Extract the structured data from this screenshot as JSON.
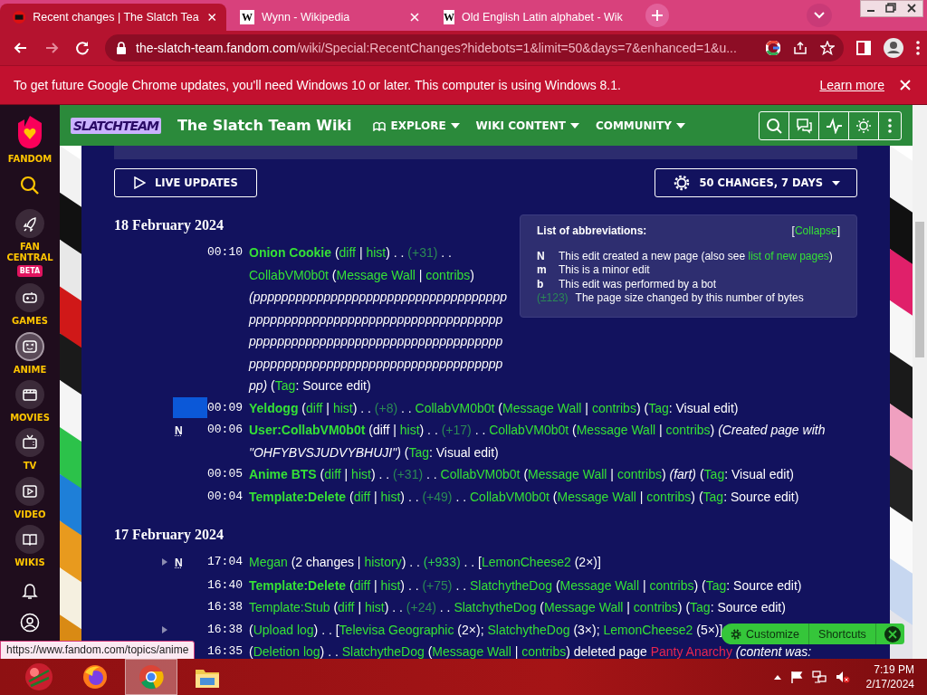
{
  "tabs": [
    {
      "title": "Recent changes | The Slatch Tea",
      "kind": "fandom",
      "selected": true
    },
    {
      "title": "Wynn - Wikipedia",
      "kind": "wikipedia",
      "icon_text": "W",
      "selected": false
    },
    {
      "title": "Old English Latin alphabet - Wik",
      "kind": "wikipedia",
      "icon_text": "W",
      "selected": false
    }
  ],
  "toolbar": {
    "nav": [
      {
        "kind": "back",
        "disabled": false
      },
      {
        "kind": "forward",
        "disabled": true
      },
      {
        "kind": "reload",
        "disabled": false
      }
    ],
    "url_host": "the-slatch-team.fandom.com",
    "url_path": "/wiki/Special:RecentChanges?hidebots=1&limit=50&days=7&enhanced=1&u..."
  },
  "infobar": {
    "message": "To get future Google Chrome updates, you'll need Windows 10 or later. This computer is using Windows 8.1.",
    "link": "Learn more"
  },
  "rail": {
    "logo_label": "FANDOM",
    "items": [
      {
        "label": "FAN CENTRAL",
        "kind": "rocket",
        "badge": "BETA",
        "selected": false
      },
      {
        "label": "GAMES",
        "kind": "gamepad",
        "selected": false
      },
      {
        "label": "ANIME",
        "kind": "face",
        "selected": true
      },
      {
        "label": "MOVIES",
        "kind": "clapper",
        "selected": false
      },
      {
        "label": "TV",
        "kind": "tv",
        "selected": false
      },
      {
        "label": "VIDEO",
        "kind": "play",
        "selected": false
      },
      {
        "label": "WIKIS",
        "kind": "book",
        "selected": false
      }
    ]
  },
  "wiki_header": {
    "logo_text": "SLATCHTEAM",
    "title": "The Slatch Team Wiki",
    "nav": [
      "EXPLORE",
      "WIKI CONTENT",
      "COMMUNITY"
    ]
  },
  "controls": {
    "live_updates": "LIVE UPDATES",
    "filter": "50 CHANGES, 7 DAYS"
  },
  "abbreviations": {
    "title": "List of abbreviations:",
    "collapse": [
      {
        "kind": "text",
        "text": "["
      },
      {
        "kind": "link",
        "text": "Collapse"
      },
      {
        "kind": "text",
        "text": "]"
      }
    ],
    "items": [
      {
        "key": "N",
        "kind": "letter",
        "desc": [
          {
            "kind": "text",
            "text": "This edit created a new page (also see "
          },
          {
            "kind": "link",
            "text": "list of new pages"
          },
          {
            "kind": "text",
            "text": ")"
          }
        ]
      },
      {
        "key": "m",
        "kind": "letter",
        "desc": [
          {
            "kind": "text",
            "text": "This is a minor edit"
          }
        ]
      },
      {
        "key": "b",
        "kind": "letter",
        "desc": [
          {
            "kind": "text",
            "text": "This edit was performed by a bot"
          }
        ]
      },
      {
        "key": "(±123)",
        "kind": "size",
        "desc": [
          {
            "kind": "text",
            "text": "The page size changed by this number of bytes"
          }
        ]
      }
    ]
  },
  "days": [
    {
      "date": "18 February 2024",
      "entries": [
        {
          "time": "00:10",
          "grouped": false,
          "marked": false,
          "parts": [
            {
              "kind": "title",
              "text": "Onion Cookie"
            },
            {
              "kind": "text",
              "text": " ("
            },
            {
              "kind": "link",
              "text": "diff"
            },
            {
              "kind": "text",
              "text": " | "
            },
            {
              "kind": "link",
              "text": "hist"
            },
            {
              "kind": "text",
              "text": ") . . "
            },
            {
              "kind": "size",
              "text": "(+31)"
            },
            {
              "kind": "text",
              "text": " . . "
            },
            {
              "kind": "link",
              "text": "CollabVM0b0t"
            },
            {
              "kind": "text",
              "text": " ("
            },
            {
              "kind": "link",
              "text": "Message Wall"
            },
            {
              "kind": "text",
              "text": " | "
            },
            {
              "kind": "link",
              "text": "contribs"
            },
            {
              "kind": "text",
              "text": ") "
            },
            {
              "kind": "italic",
              "text": "(pppppppppppppppppppppppppppppppppppppppppppppppppppppppppppppppppppppppppppppppppppppppppppppppppppppppppppppppppppppppppppppppppppppppppppppppppp)"
            },
            {
              "kind": "text",
              "text": " ("
            },
            {
              "kind": "link",
              "text": "Tag"
            },
            {
              "kind": "text",
              "text": ": Source edit)"
            }
          ]
        },
        {
          "time": "00:09",
          "grouped": false,
          "marked": true,
          "parts": [
            {
              "kind": "title",
              "text": "Yeldogg"
            },
            {
              "kind": "text",
              "text": " ("
            },
            {
              "kind": "link",
              "text": "diff"
            },
            {
              "kind": "text",
              "text": " | "
            },
            {
              "kind": "link",
              "text": "hist"
            },
            {
              "kind": "text",
              "text": ") . . "
            },
            {
              "kind": "size",
              "text": "(+8)"
            },
            {
              "kind": "text",
              "text": " . . "
            },
            {
              "kind": "link",
              "text": "CollabVM0b0t"
            },
            {
              "kind": "text",
              "text": " ("
            },
            {
              "kind": "link",
              "text": "Message Wall"
            },
            {
              "kind": "text",
              "text": " | "
            },
            {
              "kind": "link",
              "text": "contribs"
            },
            {
              "kind": "text",
              "text": ") ("
            },
            {
              "kind": "link",
              "text": "Tag"
            },
            {
              "kind": "text",
              "text": ": Visual edit)"
            }
          ]
        },
        {
          "time": "00:06",
          "flag": "N",
          "grouped": false,
          "marked": false,
          "parts": [
            {
              "kind": "title",
              "text": "User:CollabVM0b0t"
            },
            {
              "kind": "text",
              "text": " (diff | "
            },
            {
              "kind": "link",
              "text": "hist"
            },
            {
              "kind": "text",
              "text": ") . . "
            },
            {
              "kind": "size",
              "text": "(+17)"
            },
            {
              "kind": "text",
              "text": " . . "
            },
            {
              "kind": "link",
              "text": "CollabVM0b0t"
            },
            {
              "kind": "text",
              "text": " ("
            },
            {
              "kind": "link",
              "text": "Message Wall"
            },
            {
              "kind": "text",
              "text": " | "
            },
            {
              "kind": "link",
              "text": "contribs"
            },
            {
              "kind": "text",
              "text": ") "
            },
            {
              "kind": "italic",
              "text": "(Created page with \"OHFYBVSJUDVYBHUJI\")"
            },
            {
              "kind": "text",
              "text": " ("
            },
            {
              "kind": "link",
              "text": "Tag"
            },
            {
              "kind": "text",
              "text": ": Visual edit)"
            }
          ]
        },
        {
          "time": "00:05",
          "grouped": false,
          "marked": false,
          "parts": [
            {
              "kind": "title",
              "text": "Anime BTS"
            },
            {
              "kind": "text",
              "text": " ("
            },
            {
              "kind": "link",
              "text": "diff"
            },
            {
              "kind": "text",
              "text": " | "
            },
            {
              "kind": "link",
              "text": "hist"
            },
            {
              "kind": "text",
              "text": ") . . "
            },
            {
              "kind": "size",
              "text": "(+31)"
            },
            {
              "kind": "text",
              "text": " . . "
            },
            {
              "kind": "link",
              "text": "CollabVM0b0t"
            },
            {
              "kind": "text",
              "text": " ("
            },
            {
              "kind": "link",
              "text": "Message Wall"
            },
            {
              "kind": "text",
              "text": " | "
            },
            {
              "kind": "link",
              "text": "contribs"
            },
            {
              "kind": "text",
              "text": ") "
            },
            {
              "kind": "italic",
              "text": "(fart)"
            },
            {
              "kind": "text",
              "text": " ("
            },
            {
              "kind": "link",
              "text": "Tag"
            },
            {
              "kind": "text",
              "text": ": Visual edit)"
            }
          ]
        },
        {
          "time": "00:04",
          "grouped": false,
          "marked": false,
          "parts": [
            {
              "kind": "title",
              "text": "Template:Delete"
            },
            {
              "kind": "text",
              "text": " ("
            },
            {
              "kind": "link",
              "text": "diff"
            },
            {
              "kind": "text",
              "text": " | "
            },
            {
              "kind": "link",
              "text": "hist"
            },
            {
              "kind": "text",
              "text": ") . . "
            },
            {
              "kind": "size",
              "text": "(+49)"
            },
            {
              "kind": "text",
              "text": " . . "
            },
            {
              "kind": "link",
              "text": "CollabVM0b0t"
            },
            {
              "kind": "text",
              "text": " ("
            },
            {
              "kind": "link",
              "text": "Message Wall"
            },
            {
              "kind": "text",
              "text": " | "
            },
            {
              "kind": "link",
              "text": "contribs"
            },
            {
              "kind": "text",
              "text": ") ("
            },
            {
              "kind": "link",
              "text": "Tag"
            },
            {
              "kind": "text",
              "text": ": Source edit)"
            }
          ]
        }
      ]
    },
    {
      "date": "17 February 2024",
      "entries": [
        {
          "time": "17:04",
          "flag": "N",
          "grouped": true,
          "marked": false,
          "parts": [
            {
              "kind": "link",
              "text": "Megan"
            },
            {
              "kind": "text",
              "text": " (2 changes | "
            },
            {
              "kind": "link",
              "text": "history"
            },
            {
              "kind": "text",
              "text": ") . . "
            },
            {
              "kind": "size_big",
              "text": "(+933)"
            },
            {
              "kind": "text",
              "text": " . . ["
            },
            {
              "kind": "link",
              "text": "LemonCheese2"
            },
            {
              "kind": "text",
              "text": " (2×)]"
            }
          ]
        },
        {
          "time": "16:40",
          "grouped": false,
          "marked": false,
          "parts": [
            {
              "kind": "title",
              "text": "Template:Delete"
            },
            {
              "kind": "text",
              "text": " ("
            },
            {
              "kind": "link",
              "text": "diff"
            },
            {
              "kind": "text",
              "text": " | "
            },
            {
              "kind": "link",
              "text": "hist"
            },
            {
              "kind": "text",
              "text": ") . . "
            },
            {
              "kind": "size",
              "text": "(+75)"
            },
            {
              "kind": "text",
              "text": " . . "
            },
            {
              "kind": "link",
              "text": "SlatchytheDog"
            },
            {
              "kind": "text",
              "text": " ("
            },
            {
              "kind": "link",
              "text": "Message Wall"
            },
            {
              "kind": "text",
              "text": " | "
            },
            {
              "kind": "link",
              "text": "contribs"
            },
            {
              "kind": "text",
              "text": ") ("
            },
            {
              "kind": "link",
              "text": "Tag"
            },
            {
              "kind": "text",
              "text": ": Source edit)"
            }
          ]
        },
        {
          "time": "16:38",
          "grouped": false,
          "marked": false,
          "parts": [
            {
              "kind": "link",
              "text": "Template:Stub"
            },
            {
              "kind": "text",
              "text": " ("
            },
            {
              "kind": "link",
              "text": "diff"
            },
            {
              "kind": "text",
              "text": " | "
            },
            {
              "kind": "link",
              "text": "hist"
            },
            {
              "kind": "text",
              "text": ") . . "
            },
            {
              "kind": "size",
              "text": "(+24)"
            },
            {
              "kind": "text",
              "text": " . . "
            },
            {
              "kind": "link",
              "text": "SlatchytheDog"
            },
            {
              "kind": "text",
              "text": " ("
            },
            {
              "kind": "link",
              "text": "Message Wall"
            },
            {
              "kind": "text",
              "text": " | "
            },
            {
              "kind": "link",
              "text": "contribs"
            },
            {
              "kind": "text",
              "text": ") ("
            },
            {
              "kind": "link",
              "text": "Tag"
            },
            {
              "kind": "text",
              "text": ": Source edit)"
            }
          ]
        },
        {
          "time": "16:38",
          "grouped": true,
          "marked": false,
          "parts": [
            {
              "kind": "text",
              "text": "("
            },
            {
              "kind": "link",
              "text": "Upload log"
            },
            {
              "kind": "text",
              "text": ") . . ["
            },
            {
              "kind": "link",
              "text": "Televisa Geographic"
            },
            {
              "kind": "text",
              "text": " (2×); "
            },
            {
              "kind": "link",
              "text": "SlatchytheDog"
            },
            {
              "kind": "text",
              "text": " (3×); "
            },
            {
              "kind": "link",
              "text": "LemonCheese2"
            },
            {
              "kind": "text",
              "text": " (5×)]"
            }
          ]
        },
        {
          "time": "16:35",
          "grouped": false,
          "marked": false,
          "parts": [
            {
              "kind": "text",
              "text": "("
            },
            {
              "kind": "link",
              "text": "Deletion log"
            },
            {
              "kind": "text",
              "text": ") . . "
            },
            {
              "kind": "link",
              "text": "SlatchytheDog"
            },
            {
              "kind": "text",
              "text": " ("
            },
            {
              "kind": "link",
              "text": "Message Wall"
            },
            {
              "kind": "text",
              "text": " | "
            },
            {
              "kind": "link",
              "text": "contribs"
            },
            {
              "kind": "text",
              "text": ") deleted page "
            },
            {
              "kind": "redlink",
              "text": "Panty Anarchy"
            },
            {
              "kind": "italic",
              "text": " (content was:"
            }
          ]
        }
      ]
    }
  ],
  "floating_bar": [
    "Customize",
    "Shortcuts"
  ],
  "status_url": "https://www.fandom.com/topics/anime",
  "taskbar": {
    "apps": [
      {
        "kind": "start",
        "selected": false
      },
      {
        "kind": "firefox",
        "selected": false
      },
      {
        "kind": "chrome",
        "selected": true
      },
      {
        "kind": "explorer",
        "selected": false
      }
    ],
    "time": "7:19 PM",
    "date": "2/17/2024"
  }
}
